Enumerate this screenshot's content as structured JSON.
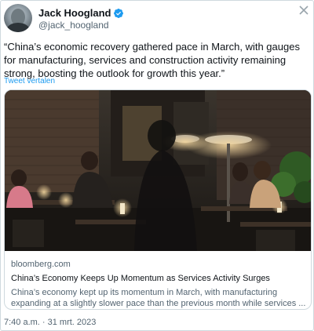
{
  "author": {
    "display_name": "Jack Hoogland",
    "handle": "@jack_hoogland",
    "verified": true
  },
  "tweet": {
    "text": "“China’s economic recovery gathered pace in March, with gauges for manufacturing, services and construction activity remaining strong, boosting the outlook for growth this year.”",
    "translate_label": "Tweet vertalen",
    "timestamp": "7:40 a.m. · 31 mrt. 2023"
  },
  "card": {
    "domain": "bloomberg.com",
    "title": "China’s Economy Keeps Up Momentum as Services Activity Surges",
    "description": "China’s economy kept up its momentum in March, with manufacturing expanding at a slightly slower pace than the previous month while services ..."
  },
  "colors": {
    "accent": "#1d9bf0",
    "text": "#0f1419",
    "secondary_text": "#536471",
    "border": "#cfd9de"
  },
  "icons": {
    "verified": "verified-badge-icon",
    "close": "close-icon"
  }
}
